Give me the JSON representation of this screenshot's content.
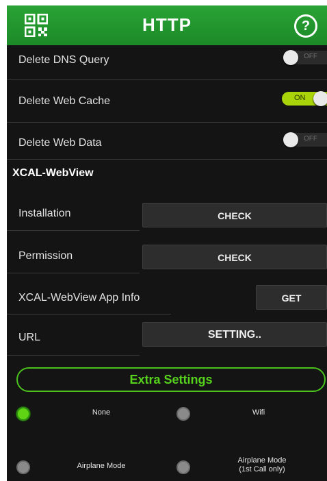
{
  "header": {
    "title": "HTTP",
    "qr_icon": "qr-code-icon",
    "help_icon": "help-circle-icon",
    "accent": "#1f9a2b"
  },
  "toggles": [
    {
      "label": "Delete DNS Query",
      "state": "OFF",
      "on": false
    },
    {
      "label": "Delete Web Cache",
      "state": "ON",
      "on": true
    },
    {
      "label": "Delete Web Data",
      "state": "OFF",
      "on": false
    }
  ],
  "webview": {
    "section_title": "XCAL-WebView",
    "installation": {
      "label": "Installation",
      "button": "CHECK"
    },
    "permission": {
      "label": "Permission",
      "button": "CHECK"
    },
    "app_info": {
      "label": "XCAL-WebView App Info",
      "button": "GET"
    },
    "url": {
      "label": "URL",
      "button": "SETTING.."
    }
  },
  "extra_settings": {
    "label": "Extra Settings",
    "color": "#4cc31c"
  },
  "network_options": [
    {
      "label": "None",
      "selected": true
    },
    {
      "label": "Wifi",
      "selected": false
    },
    {
      "label": "Airplane Mode",
      "selected": false
    },
    {
      "label_line1": "Airplane Mode",
      "label_line2": "(1st Call only)",
      "selected": false
    }
  ]
}
